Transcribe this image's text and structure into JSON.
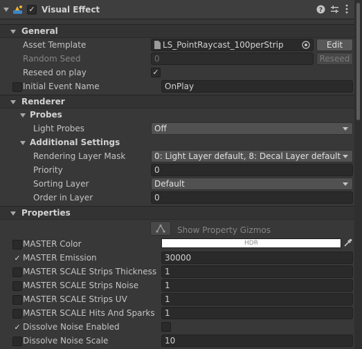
{
  "component": {
    "title": "Visual Effect",
    "enabled_mark": "✓"
  },
  "general": {
    "title": "General",
    "asset_template_label": "Asset Template",
    "asset_template_value": "LS_PointRaycast_100perStrip",
    "edit_label": "Edit",
    "random_seed_label": "Random Seed",
    "random_seed_value": "0",
    "reseed_button_label": "Reseed",
    "reseed_on_play_label": "Reseed on play",
    "reseed_on_play_mark": "✓",
    "initial_event_label": "Initial Event Name",
    "initial_event_value": "OnPlay"
  },
  "renderer": {
    "title": "Renderer",
    "probes_title": "Probes",
    "light_probes_label": "Light Probes",
    "light_probes_value": "Off",
    "additional_title": "Additional Settings",
    "rendering_layer_mask_label": "Rendering Layer Mask",
    "rendering_layer_mask_value": "0: Light Layer default, 8: Decal Layer default",
    "priority_label": "Priority",
    "priority_value": "0",
    "sorting_layer_label": "Sorting Layer",
    "sorting_layer_value": "Default",
    "order_in_layer_label": "Order in Layer",
    "order_in_layer_value": "0"
  },
  "properties": {
    "title": "Properties",
    "show_gizmos_label": "Show Property Gizmos",
    "hdr_label": "HDR",
    "master_color_swatch": "#ffffff",
    "rows": [
      {
        "label": "MASTER Color",
        "checked": "",
        "value": ""
      },
      {
        "label": "MASTER Emission",
        "checked": "✓",
        "value": "30000"
      },
      {
        "label": "MASTER SCALE Strips Thickness",
        "checked": "",
        "value": "1"
      },
      {
        "label": "MASTER SCALE Strips Noise",
        "checked": "",
        "value": "1"
      },
      {
        "label": "MASTER SCALE Strips UV",
        "checked": "",
        "value": "1"
      },
      {
        "label": "MASTER SCALE Hits And Sparks",
        "checked": "",
        "value": "1"
      },
      {
        "label": "Dissolve Noise Enabled",
        "checked": "✓",
        "value": ""
      },
      {
        "label": "Dissolve Noise Scale",
        "checked": "",
        "value": "10"
      }
    ]
  },
  "icons": {
    "foldout": "triangle-down",
    "component": "vfx-graph-icon",
    "help": "help-icon",
    "presets": "presets-icon",
    "menu": "kebab-menu-icon",
    "target": "object-picker-icon",
    "asset": "vfx-asset-icon",
    "gizmo": "gizmo-icon",
    "eyedropper": "eyedropper-icon"
  }
}
